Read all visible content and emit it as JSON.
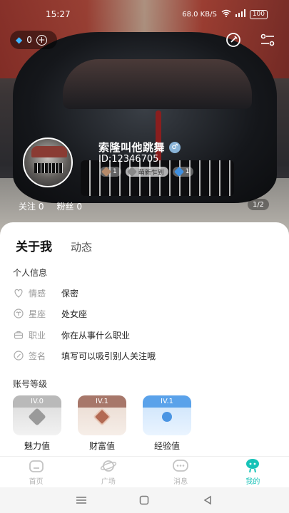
{
  "status_bar": {
    "time": "15:27",
    "speed": "68.0 KB/S",
    "battery": "100"
  },
  "diamond": {
    "count": "0"
  },
  "profile": {
    "username": "索隆叫他跳舞",
    "user_id": "ID:12346705",
    "badges": [
      {
        "value": "1"
      },
      {
        "label": "萌新乍到"
      },
      {
        "value": "1"
      }
    ],
    "follow_label": "关注",
    "follow_count": "0",
    "fans_label": "粉丝",
    "fans_count": "0",
    "page_indicator": "1/2"
  },
  "tabs": {
    "about": "关于我",
    "moments": "动态"
  },
  "personal_info": {
    "title": "个人信息",
    "rows": [
      {
        "label": "情感",
        "value": "保密",
        "icon": "heart-icon"
      },
      {
        "label": "星座",
        "value": "处女座",
        "icon": "zodiac-icon"
      },
      {
        "label": "职业",
        "value": "你在从事什么职业",
        "icon": "briefcase-icon"
      },
      {
        "label": "签名",
        "value": "填写可以吸引别人关注哦",
        "icon": "edit-icon"
      }
    ]
  },
  "account_level": {
    "title": "账号等级",
    "cards": [
      {
        "tag": "IV.0",
        "name": "魅力值",
        "color": "#b9b9b9"
      },
      {
        "tag": "IV.1",
        "name": "财富值",
        "color": "#a7776a"
      },
      {
        "tag": "IV.1",
        "name": "经验值",
        "color": "#5aa2ea"
      }
    ]
  },
  "tabbar": {
    "items": [
      {
        "label": "首页",
        "icon": "home-icon"
      },
      {
        "label": "广场",
        "icon": "planet-icon"
      },
      {
        "label": "消息",
        "icon": "chat-icon"
      },
      {
        "label": "我的",
        "icon": "profile-icon",
        "active": true
      }
    ],
    "active_color": "#17c3b8"
  }
}
